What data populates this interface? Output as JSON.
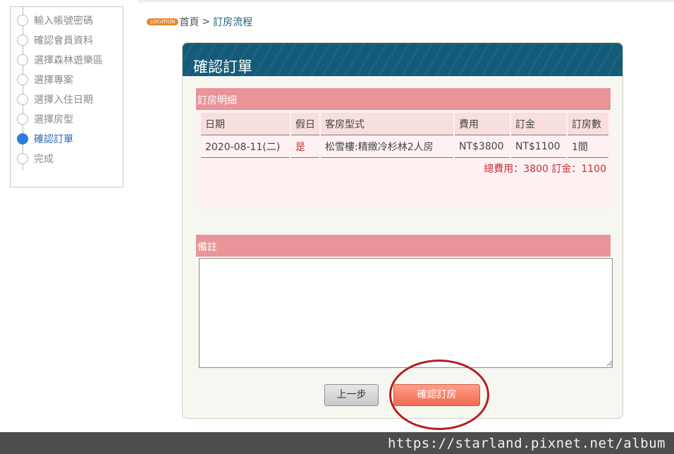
{
  "breadcrumb": {
    "badge": "LOCATION",
    "home": "首頁",
    "separator": ">",
    "current": "訂房流程"
  },
  "steps": [
    {
      "label": "輸入帳號密碼",
      "active": false
    },
    {
      "label": "確認會員資料",
      "active": false
    },
    {
      "label": "選擇森林遊樂區",
      "active": false
    },
    {
      "label": "選擇專案",
      "active": false
    },
    {
      "label": "選擇入住日期",
      "active": false
    },
    {
      "label": "選擇房型",
      "active": false
    },
    {
      "label": "確認訂單",
      "active": true
    },
    {
      "label": "完成",
      "active": false
    }
  ],
  "panel": {
    "title": "確認訂單",
    "order_section_title": "訂房明細",
    "columns": [
      "日期",
      "假日",
      "客房型式",
      "費用",
      "訂金",
      "訂房數"
    ],
    "rows": [
      {
        "date": "2020-08-11(二)",
        "holiday": "是",
        "room_type": "松雪樓:精緻冷杉林2人房",
        "fee": "NT$3800",
        "deposit": "NT$1100",
        "rooms": "1間"
      }
    ],
    "totals": "總費用：3800 訂金：1100",
    "remark_section_title": "備註",
    "remark_value": ""
  },
  "buttons": {
    "prev": "上一步",
    "confirm": "確認訂房"
  },
  "watermark": "https://starland.pixnet.net/album",
  "colors": {
    "header_blue": "#155b78",
    "section_pink": "#e89499",
    "active_step": "#2b7fd9",
    "total_red": "#c62f3a",
    "annotation_circle": "#b21f23"
  }
}
